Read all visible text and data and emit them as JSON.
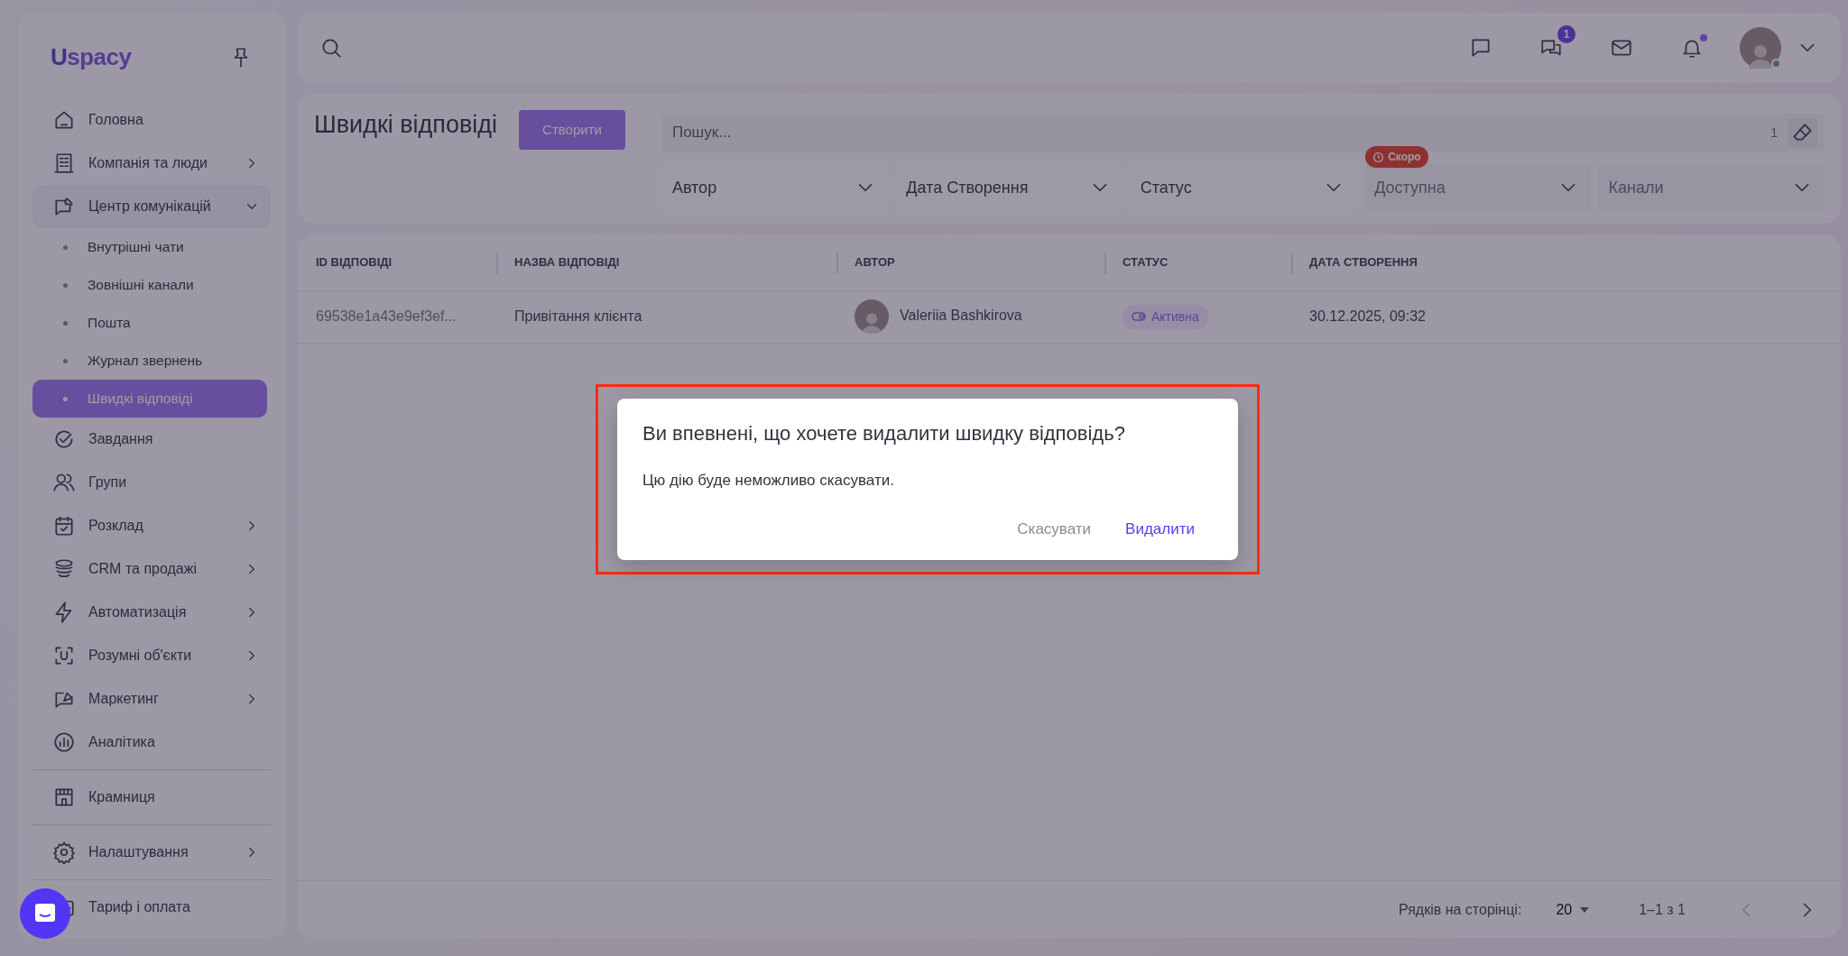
{
  "sidebar": {
    "logo_letter": "U",
    "logo_text": "spacy",
    "items": [
      {
        "kind": "item",
        "label": "Головна",
        "selected": false
      },
      {
        "kind": "item",
        "label": "Компанія та люди",
        "selected": false,
        "expanded": false
      },
      {
        "kind": "item",
        "label": "Центр комунікацій",
        "selected": false,
        "expanded": true,
        "children": [
          {
            "label": "Внутрішні чати",
            "selected": false
          },
          {
            "label": "Зовнішні канали",
            "selected": false
          },
          {
            "label": "Пошта",
            "selected": false
          },
          {
            "label": "Журнал звернень",
            "selected": false
          },
          {
            "label": "Швидкі відповіді",
            "selected": true
          }
        ]
      },
      {
        "kind": "item",
        "label": "Завдання",
        "selected": false
      },
      {
        "kind": "item",
        "label": "Групи",
        "selected": false
      },
      {
        "kind": "item",
        "label": "Розклад",
        "selected": false,
        "expanded": false
      },
      {
        "kind": "item",
        "label": "CRM та продажі",
        "selected": false,
        "expanded": false
      },
      {
        "kind": "item",
        "label": "Автоматизація",
        "selected": false,
        "expanded": false
      },
      {
        "kind": "item",
        "label": "Розумні об'єкти",
        "selected": false,
        "expanded": false
      },
      {
        "kind": "item",
        "label": "Маркетинг",
        "selected": false,
        "expanded": false
      },
      {
        "kind": "item",
        "label": "Аналітика",
        "selected": false
      },
      {
        "kind": "divider"
      },
      {
        "kind": "item",
        "label": "Крамниця",
        "selected": false
      },
      {
        "kind": "divider"
      },
      {
        "kind": "item",
        "label": "Налаштування",
        "selected": false,
        "expanded": false
      },
      {
        "kind": "divider"
      },
      {
        "kind": "item",
        "label": "Тариф і оплата",
        "selected": false
      }
    ]
  },
  "topbar": {
    "chat_badge": "1",
    "notifications_unread": true,
    "user_online": true
  },
  "page": {
    "title": "Швидкі відповіді",
    "create_button": "Створити",
    "search": {
      "placeholder": "Пошук...",
      "count": "1"
    },
    "filters": [
      {
        "label": "Автор",
        "disabled": false
      },
      {
        "label": "Дата Створення",
        "disabled": false
      },
      {
        "label": "Статус",
        "disabled": false
      },
      {
        "label": "Доступна",
        "disabled": true,
        "badge": "Скоро"
      },
      {
        "label": "Канали",
        "disabled": true
      }
    ]
  },
  "table": {
    "columns": [
      "ID ВІДПОВІДІ",
      "НАЗВА ВІДПОВІДІ",
      "АВТОР",
      "СТАТУС",
      "ДАТА СТВОРЕННЯ"
    ],
    "rows": [
      {
        "id": "69538e1a43e9ef3ef...",
        "name": "Привітання клієнта",
        "author": "Valeriia Bashkirova",
        "status": "Активна",
        "date": "30.12.2025, 09:32"
      }
    ],
    "footer": {
      "rows_label": "Рядків на сторінці:",
      "rows_value": "20",
      "range": "1–1 з 1",
      "prev_disabled": true,
      "next_disabled": false
    }
  },
  "dialog": {
    "title": "Ви впевнені, що хочете видалити швидку відповідь?",
    "text": "Цю дію буде неможливо скасувати.",
    "buttons": [
      {
        "label": "Скасувати",
        "kind": "cancel"
      },
      {
        "label": "Видалити",
        "kind": "confirm"
      }
    ],
    "highlighted": true
  }
}
